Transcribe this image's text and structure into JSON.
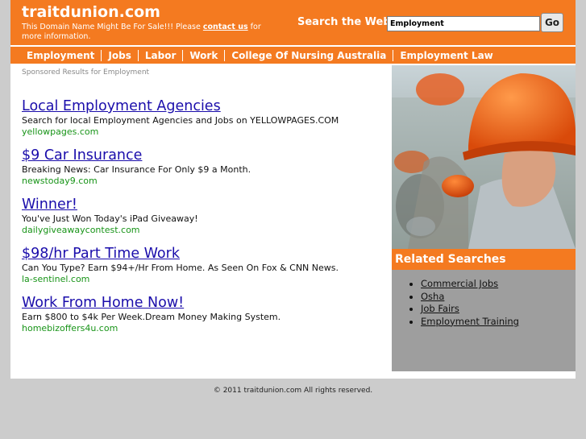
{
  "header": {
    "site_title": "traitdunion.com",
    "sale_text_before": "This Domain Name Might Be For Sale!!! Please ",
    "sale_link": "contact us",
    "sale_text_after": " for more information.",
    "search_label": "Search the Web:",
    "search_value": "Employment",
    "go_label": "Go"
  },
  "nav": [
    "Employment",
    "Jobs",
    "Labor",
    "Work",
    "College Of Nursing Australia",
    "Employment Law"
  ],
  "sponsored_label": "Sponsored Results for Employment",
  "ads": [
    {
      "title": "Local Employment Agencies",
      "desc": "Search for local Employment Agencies and Jobs on YELLOWPAGES.COM",
      "url": "yellowpages.com"
    },
    {
      "title": "$9 Car Insurance",
      "desc": "Breaking News: Car Insurance For Only $9 a Month.",
      "url": "newstoday9.com"
    },
    {
      "title": "Winner!",
      "desc": "You've Just Won Today's iPad Giveaway!",
      "url": "dailygiveawaycontest.com"
    },
    {
      "title": "$98/hr Part Time Work",
      "desc": "Can You Type? Earn $94+/Hr From Home. As Seen On Fox & CNN News.",
      "url": "la-sentinel.com"
    },
    {
      "title": "Work From Home Now!",
      "desc": "Earn $800 to $4k Per Week.Dream Money Making System.",
      "url": "homebizoffers4u.com"
    }
  ],
  "related": {
    "title": "Related Searches",
    "items": [
      "Commercial Jobs",
      "Osha",
      "Job Fairs",
      "Employment Training"
    ]
  },
  "footer": "© 2011 traitdunion.com All rights reserved.",
  "colors": {
    "accent": "#f47a20",
    "link": "#1a0dab",
    "url_green": "#189418"
  },
  "icons": {
    "photo": "hard-hat-workers-photo"
  }
}
